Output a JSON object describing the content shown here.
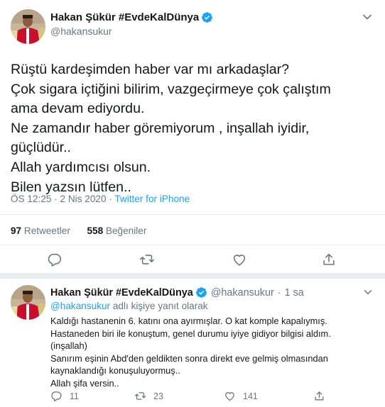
{
  "main_tweet": {
    "display_name": "Hakan Şükür #EvdeKalDünya",
    "handle": "@hakansukur",
    "text_lines": [
      "Rüştü kardeşimden haber var mı arkadaşlar?",
      "Çok sigara içtiğini bilirim, vazgeçirmeye çok çalıştım",
      "ama devam ediyordu.",
      "Ne zamandır haber göremiyorum , inşallah iyidir,",
      "güçlüdür..",
      "Allah yardımcısı olsun.",
      "Bilen yazsın lütfen.."
    ],
    "time": "ÖS 12:25",
    "date": "2 Nis 2020",
    "separator": "·",
    "source": "Twitter for iPhone",
    "retweets_count": "97",
    "retweets_label": "Retweetler",
    "likes_count": "558",
    "likes_label": "Beğeniler"
  },
  "reply": {
    "display_name": "Hakan Şükür #EvdeKalDünya",
    "handle": "@hakansukur",
    "separator": "·",
    "age": "1 sa",
    "reply_to_handle": "@hakansukur",
    "reply_to_suffix": " adlı kişiye yanıt olarak",
    "text_lines": [
      "Kaldığı  hastanenin 6. katını ona ayırmışlar. O kat komple kapalıymış.",
      "Hastaneden biri ile konuştum, genel durumu iyiye gidiyor bilgisi aldım.",
      "(inşallah)",
      "Sanırım eşinin  Abd'den geldikten sonra  direkt eve gelmiş olmasından",
      "kaynaklandığı konuşuluyormuş..",
      "Allah şifa versin.."
    ],
    "reply_count": "11",
    "retweet_count": "23",
    "like_count": "141"
  },
  "colors": {
    "accent": "#1da1f2",
    "secondary_text": "#657786",
    "divider": "#e6ecf0"
  },
  "icons": {
    "verified": "verified-badge-icon",
    "more": "chevron-down-icon",
    "reply": "speech-bubble-icon",
    "retweet": "retweet-arrows-icon",
    "like": "heart-icon",
    "share": "share-upload-icon"
  }
}
